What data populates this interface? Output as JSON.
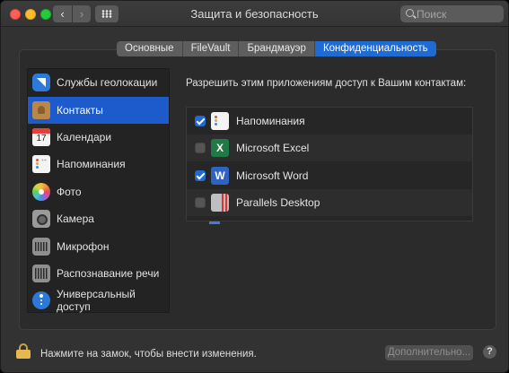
{
  "window": {
    "title": "Защита и безопасность"
  },
  "toolbar": {
    "back_icon": "chevron-left-icon",
    "back_glyph": "‹",
    "forward_icon": "chevron-right-icon",
    "forward_glyph": "›",
    "grid_icon": "grid-icon"
  },
  "search": {
    "placeholder": "Поиск",
    "value": ""
  },
  "tabs": [
    {
      "label": "Основные",
      "active": false
    },
    {
      "label": "FileVault",
      "active": false
    },
    {
      "label": "Брандмауэр",
      "active": false
    },
    {
      "label": "Конфиденциальность",
      "active": true
    }
  ],
  "sidebar": {
    "items": [
      {
        "label": "Службы геолокации",
        "icon": "location-icon",
        "selected": false
      },
      {
        "label": "Контакты",
        "icon": "contacts-icon",
        "selected": true
      },
      {
        "label": "Календари",
        "icon": "calendar-icon",
        "selected": false
      },
      {
        "label": "Напоминания",
        "icon": "reminders-icon",
        "selected": false
      },
      {
        "label": "Фото",
        "icon": "photos-icon",
        "selected": false
      },
      {
        "label": "Камера",
        "icon": "camera-icon",
        "selected": false
      },
      {
        "label": "Микрофон",
        "icon": "microphone-icon",
        "selected": false
      },
      {
        "label": "Распознавание речи",
        "icon": "speech-recognition-icon",
        "selected": false
      },
      {
        "label": "Универсальный доступ",
        "icon": "accessibility-icon",
        "selected": false
      }
    ]
  },
  "main": {
    "title": "Разрешить этим приложениям доступ к Вашим контактам:",
    "apps": [
      {
        "name": "Напоминания",
        "checked": true,
        "icon": "reminders-app-icon"
      },
      {
        "name": "Microsoft Excel",
        "checked": false,
        "icon": "excel-icon"
      },
      {
        "name": "Microsoft Word",
        "checked": true,
        "icon": "word-icon"
      },
      {
        "name": "Parallels Desktop",
        "checked": false,
        "icon": "parallels-icon"
      }
    ]
  },
  "footer": {
    "lock_text": "Нажмите на замок, чтобы внести изменения.",
    "advanced_label": "Дополнительно...",
    "help_label": "?"
  },
  "colors": {
    "accent": "#1f6ad3",
    "selection": "#1d5bcc",
    "window_bg": "#323232"
  }
}
